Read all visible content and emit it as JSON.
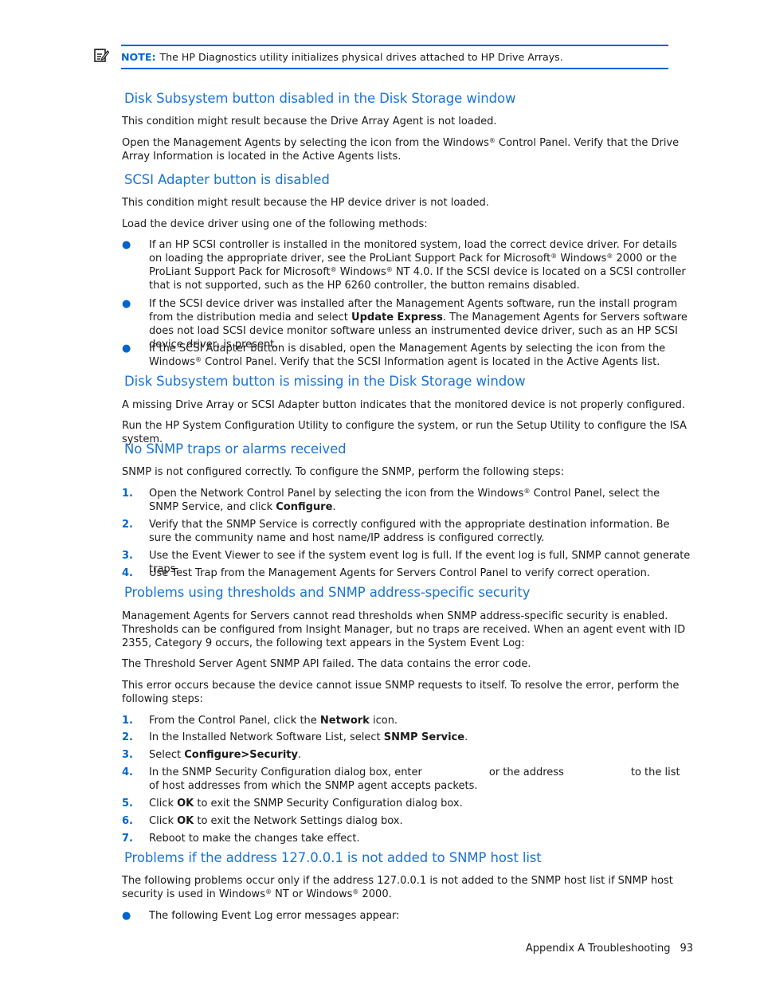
{
  "note": {
    "icon": "note-pencil-icon",
    "label": "NOTE:",
    "text": "The HP Diagnostics utility initializes physical drives attached to HP Drive Arrays."
  },
  "sections": [
    {
      "heading": "Disk Subsystem button disabled in the Disk Storage window",
      "paragraphs": [
        "This condition might result because the Drive Array Agent is not loaded.",
        "Open the Management Agents by selecting the icon from the Windows® Control Panel. Verify that the Drive Array Information is located in the Active Agents lists."
      ]
    },
    {
      "heading": "SCSI Adapter button is disabled",
      "paragraphs": [
        "This condition might result because the HP device driver is not loaded.",
        "Load the device driver using one of the following methods:"
      ],
      "bullets": [
        "If an HP SCSI controller is installed in the monitored system, load the correct device driver. For details on loading the appropriate driver, see the ProLiant Support Pack for Microsoft® Windows® 2000 or the ProLiant Support Pack for Microsoft® Windows® NT 4.0. If the SCSI device is located on a SCSI controller that is not supported, such as the HP 6260 controller, the button remains disabled.",
        "If the SCSI device driver was installed after the Management Agents software, run the install program from the distribution media and select Update Express. The Management Agents for Servers software does not load SCSI device monitor software unless an instrumented device driver, such as an HP SCSI device driver, is present.",
        "If the SCSI Adapter button is disabled, open the Management Agents by selecting the icon from the Windows® Control Panel. Verify that the SCSI Information agent is located in the Active Agents list."
      ],
      "bold_terms": [
        "Update Express"
      ]
    },
    {
      "heading": "Disk Subsystem button is missing in the Disk Storage window",
      "paragraphs": [
        "A missing Drive Array or SCSI Adapter button indicates that the monitored device is not properly configured.",
        "Run the HP System Configuration Utility to configure the system, or run the Setup Utility to configure the ISA system."
      ]
    },
    {
      "heading": "No SNMP traps or alarms received",
      "paragraphs": [
        "SNMP is not configured correctly. To configure the SNMP, perform the following steps:"
      ],
      "steps": [
        {
          "num": "1.",
          "text": "Open the Network Control Panel by selecting the icon from the Windows® Control Panel, select the SNMP Service, and click Configure."
        },
        {
          "num": "2.",
          "text": "Verify that the SNMP Service is correctly configured with the appropriate destination information. Be sure the community name and host name/IP address is configured correctly."
        },
        {
          "num": "3.",
          "text": "Use the Event Viewer to see if the system event log is full. If the event log is full, SNMP cannot generate traps."
        },
        {
          "num": "4.",
          "text": "Use Test Trap from the Management Agents for Servers Control Panel to verify correct operation."
        }
      ],
      "bold_terms": [
        "Configure"
      ]
    },
    {
      "heading": "Problems using thresholds and SNMP address-specific security",
      "paragraphs": [
        "Management Agents for Servers cannot read thresholds when SNMP address-specific security is enabled. Thresholds can be configured from Insight Manager, but no traps are received. When an agent event with ID 2355, Category 9 occurs, the following text appears in the System Event Log:",
        "The Threshold Server Agent SNMP API failed. The data contains the error code.",
        "This error occurs because the device cannot issue SNMP requests to itself. To resolve the error, perform the following steps:"
      ],
      "steps": [
        {
          "num": "1.",
          "text": "From the Control Panel, click the Network icon."
        },
        {
          "num": "2.",
          "text": "In the Installed Network Software List, select SNMP Service."
        },
        {
          "num": "3.",
          "text": "Select Configure>Security."
        },
        {
          "num": "4.",
          "text": "In the SNMP Security Configuration dialog box, enter [blank] or the address [blank] to the list of host addresses from which the SNMP agent accepts packets."
        },
        {
          "num": "5.",
          "text": "Click OK to exit the SNMP Security Configuration dialog box."
        },
        {
          "num": "6.",
          "text": "Click OK to exit the Network Settings dialog box."
        },
        {
          "num": "7.",
          "text": "Reboot to make the changes take effect."
        }
      ],
      "bold_terms": [
        "Network",
        "SNMP Service",
        "Configure>Security",
        "OK"
      ]
    },
    {
      "heading": "Problems if the address 127.0.0.1 is not added to SNMP host list",
      "paragraphs": [
        "The following problems occur only if the address 127.0.0.1 is not added to the SNMP host list if SNMP host security is used in Windows® NT or Windows® 2000."
      ],
      "bullets": [
        "The following Event Log error messages appear:"
      ]
    }
  ],
  "fragments": {
    "reg": "®",
    "s2_b2_pre": "If the SCSI device driver was installed after the Management Agents software, run the install program from the distribution media and select ",
    "s2_b2_bold": "Update Express",
    "s2_b2_post": ". The Management Agents for Servers software does not load SCSI device monitor software unless an instrumented device driver, such as an HP SCSI device driver, is present.",
    "s4_1_pre": "Open the Network Control Panel by selecting the icon from the Windows",
    "s4_1_mid": " Control Panel, select the SNMP Service, and click ",
    "s4_1_bold": "Configure",
    "s4_1_post": ".",
    "s5_1_pre": "From the Control Panel, click the ",
    "s5_1_bold": "Network",
    "s5_1_post": " icon.",
    "s5_2_pre": "In the Installed Network Software List, select ",
    "s5_2_bold": "SNMP Service",
    "s5_2_post": ".",
    "s5_3_pre": "Select ",
    "s5_3_bold": "Configure>Security",
    "s5_3_post": ".",
    "s5_4_a": "In the SNMP Security Configuration dialog box, enter",
    "s5_4_b": "or the address",
    "s5_4_c": "to the list of host addresses from which the SNMP agent accepts packets.",
    "s5_5_pre": "Click ",
    "s5_5_bold": "OK",
    "s5_5_post": " to exit the SNMP Security Configuration dialog box.",
    "s5_6_pre": "Click ",
    "s5_6_bold": "OK",
    "s5_6_post": " to exit the Network Settings dialog box."
  },
  "footer": {
    "section": "Appendix A Troubleshooting",
    "page_number": "93"
  },
  "colors": {
    "heading": "#1a73d6",
    "accent": "#0066cc",
    "text": "#1a1a1a"
  }
}
